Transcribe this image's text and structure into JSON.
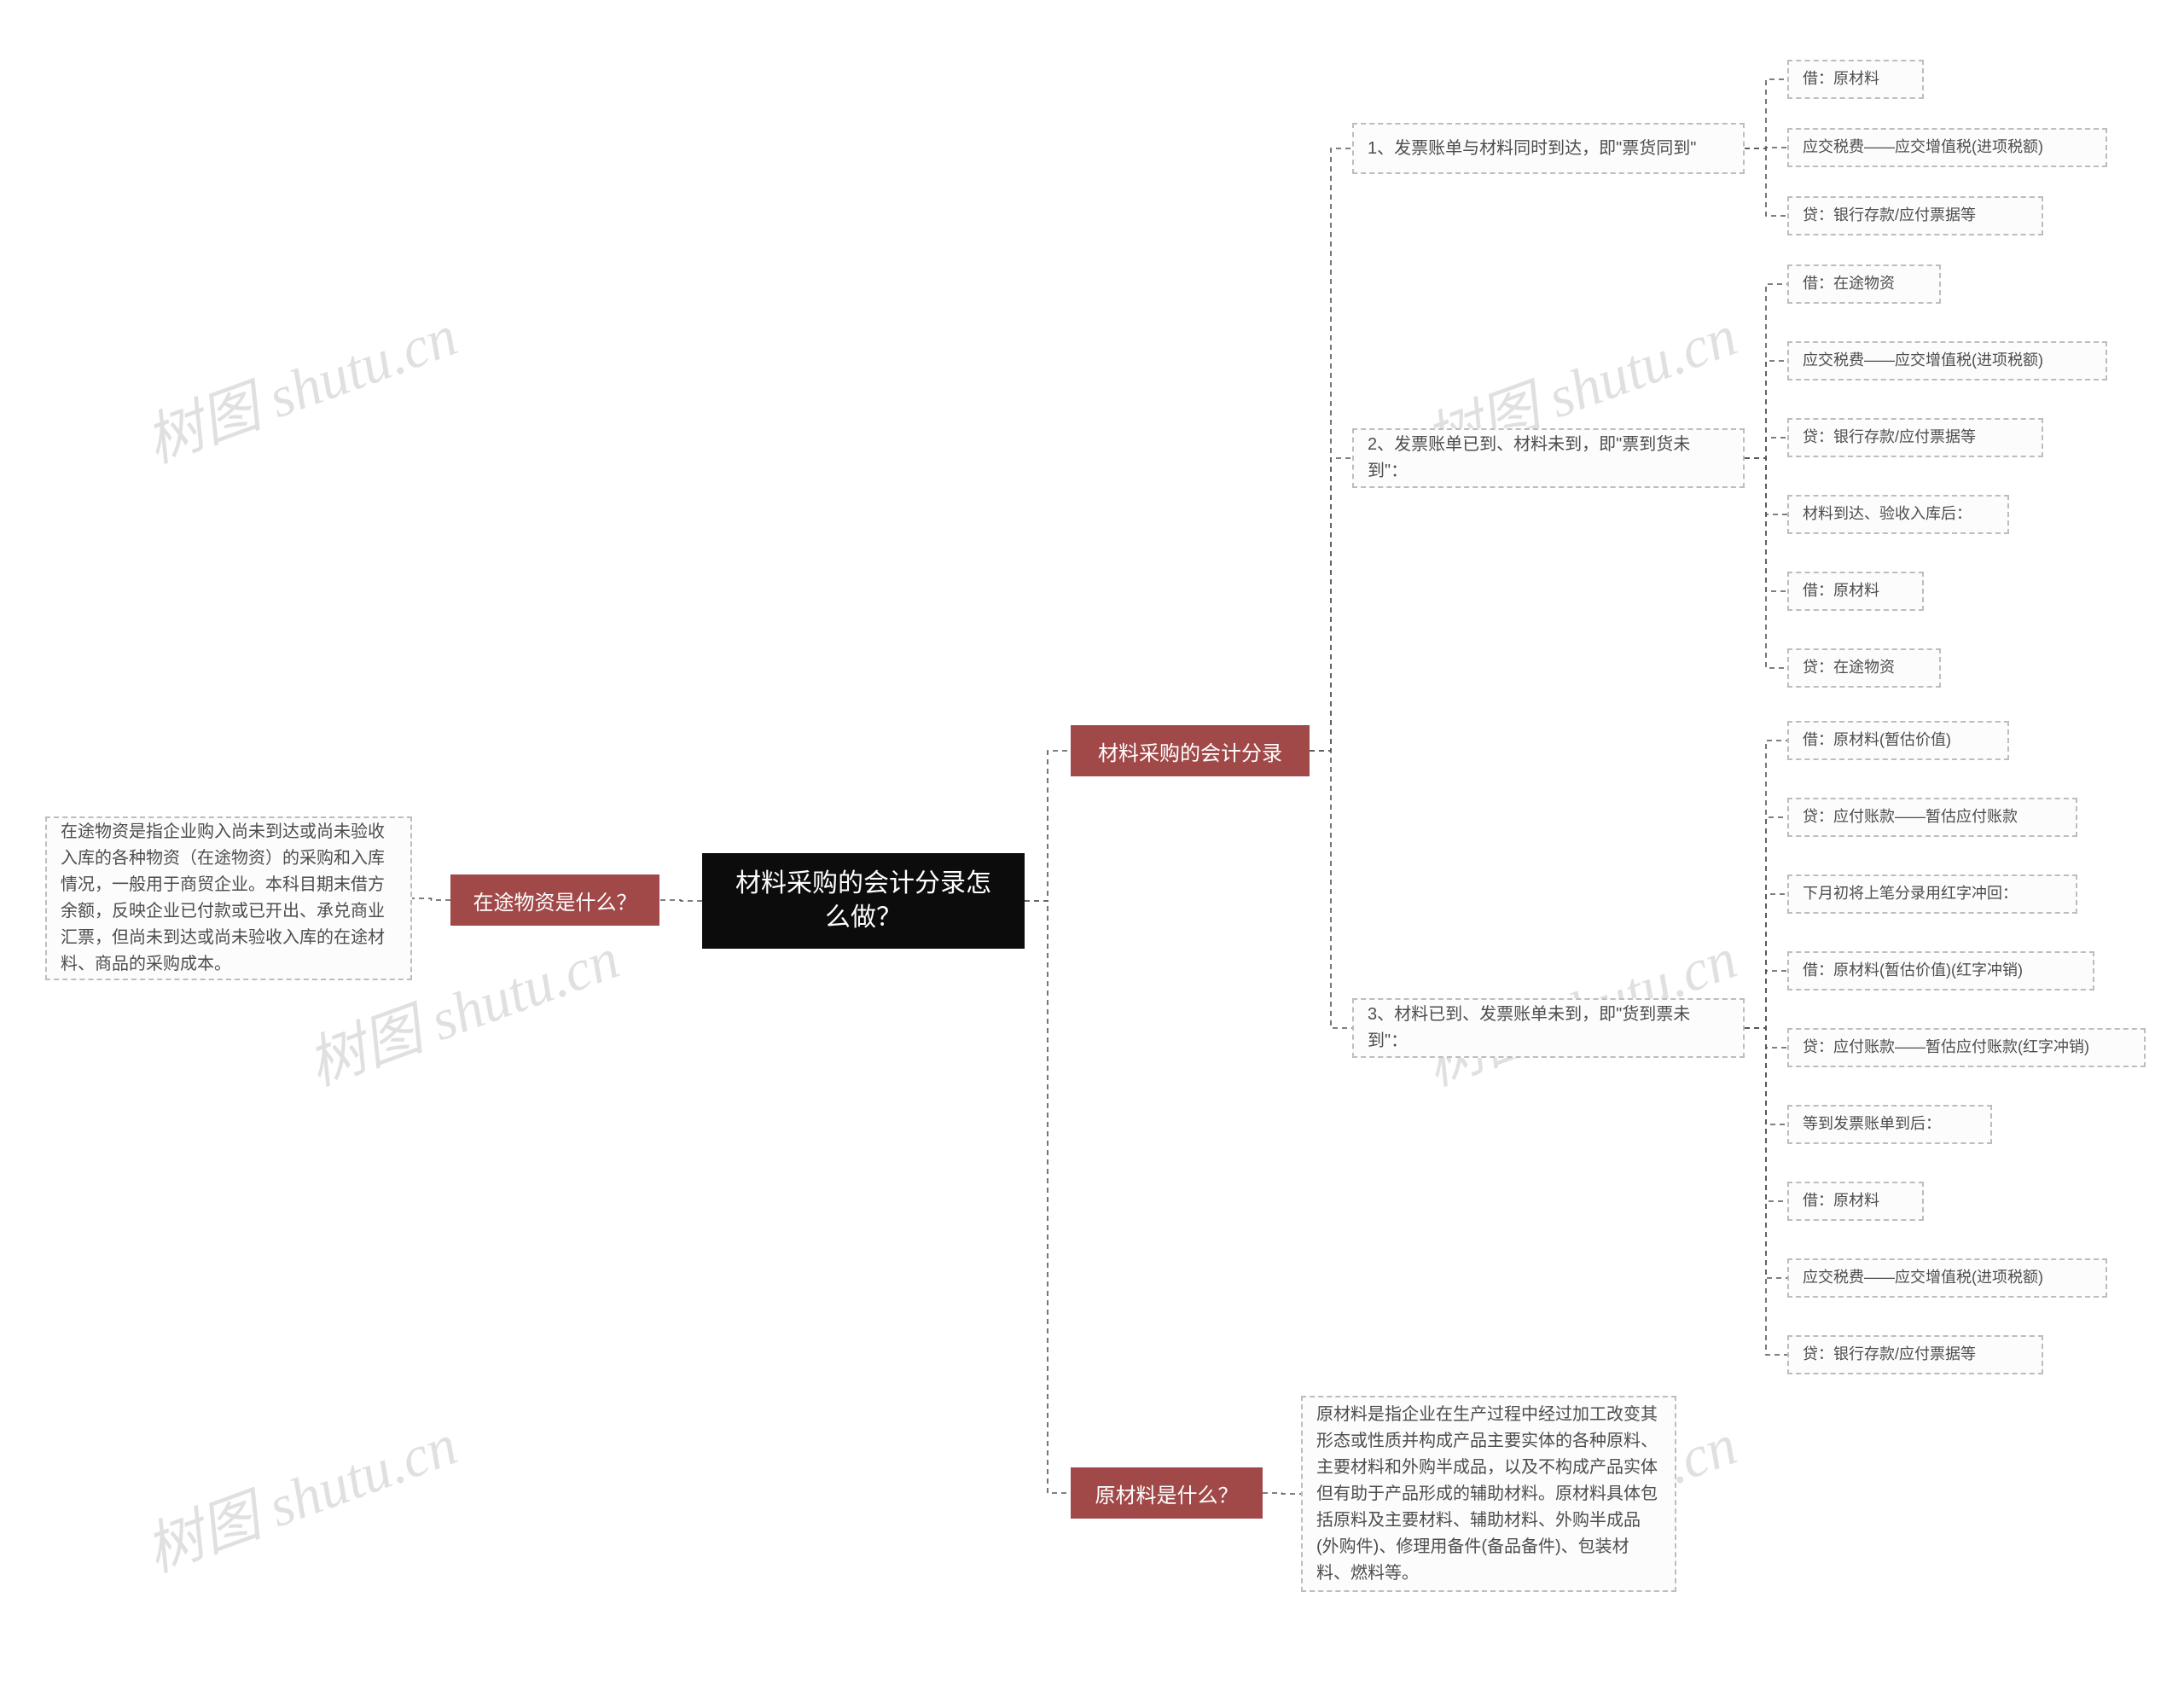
{
  "watermark": "树图 shutu.cn",
  "root": {
    "text": "材料采购的会计分录怎么做？"
  },
  "left_branch": {
    "label": "在途物资是什么？",
    "para": "在途物资是指企业购入尚未到达或尚未验收入库的各种物资（在途物资）的采购和入库情况，一般用于商贸企业。本科目期末借方余额，反映企业已付款或已开出、承兑商业汇票，但尚未到达或尚未验收入库的在途材料、商品的采购成本。"
  },
  "right_top": {
    "label": "材料采购的会计分录",
    "cases": [
      {
        "title": "1、发票账单与材料同时到达，即\"票货同到\"",
        "entries": [
          "借：原材料",
          "应交税费——应交增值税(进项税额)",
          "贷：银行存款/应付票据等"
        ]
      },
      {
        "title": "2、发票账单已到、材料未到，即\"票到货未到\"：",
        "entries": [
          "借：在途物资",
          "应交税费——应交增值税(进项税额)",
          "贷：银行存款/应付票据等",
          "材料到达、验收入库后：",
          "借：原材料",
          "贷：在途物资"
        ]
      },
      {
        "title": "3、材料已到、发票账单未到，即\"货到票未到\"：",
        "entries": [
          "借：原材料(暂估价值)",
          "贷：应付账款——暂估应付账款",
          "下月初将上笔分录用红字冲回：",
          "借：原材料(暂估价值)(红字冲销)",
          "贷：应付账款——暂估应付账款(红字冲销)",
          "等到发票账单到后：",
          "借：原材料",
          "应交税费——应交增值税(进项税额)",
          "贷：银行存款/应付票据等"
        ]
      }
    ]
  },
  "right_bottom": {
    "label": "原材料是什么？",
    "para": "原材料是指企业在生产过程中经过加工改变其形态或性质并构成产品主要实体的各种原料、主要材料和外购半成品，以及不构成产品实体但有助于产品形成的辅助材料。原材料具体包括原料及主要材料、辅助材料、外购半成品(外购件)、修理用备件(备品备件)、包装材料、燃料等。"
  }
}
